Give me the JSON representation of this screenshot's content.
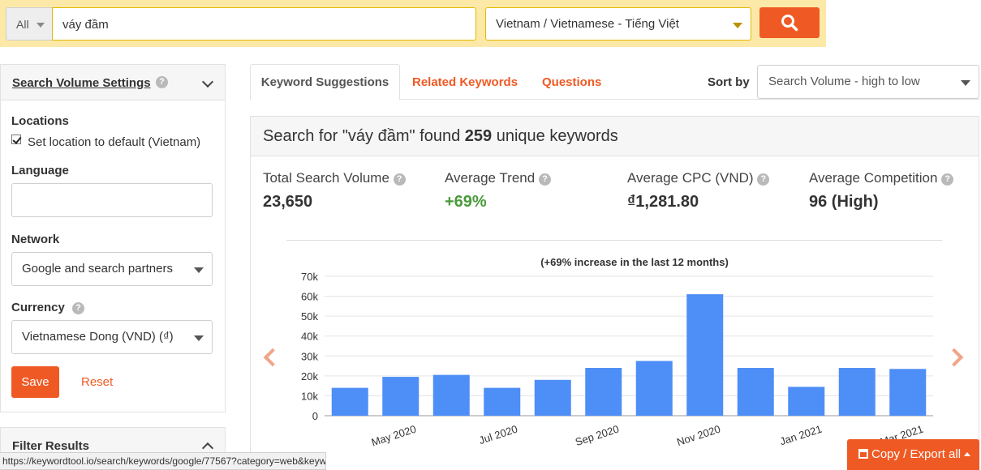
{
  "search": {
    "scope": "All",
    "query": "váy đầm",
    "language": "Vietnam / Vietnamese - Tiếng Việt"
  },
  "sidebar": {
    "title": "Search Volume Settings",
    "locations_label": "Locations",
    "location_default_label": "Set location to default (Vietnam)",
    "location_default_checked": true,
    "language_label": "Language",
    "language_value": "",
    "network_label": "Network",
    "network_value": "Google and search partners",
    "currency_label": "Currency",
    "currency_value": "Vietnamese Dong (VND) (₫)",
    "save_label": "Save",
    "reset_label": "Reset",
    "filter_title": "Filter Results"
  },
  "tabs": {
    "items": [
      "Keyword Suggestions",
      "Related Keywords",
      "Questions"
    ],
    "active": "Keyword Suggestions",
    "sort_label": "Sort by",
    "sort_value": "Search Volume - high to low"
  },
  "results": {
    "prefix": "Search for \"váy đầm\" found ",
    "count": "259",
    "suffix": " unique keywords",
    "stats": [
      {
        "label": "Total Search Volume",
        "value": "23,650"
      },
      {
        "label": "Average Trend",
        "value": "+69%"
      },
      {
        "label": "Average CPC (VND)",
        "value": "₫1,281.80"
      },
      {
        "label": "Average Competition",
        "value": "96 (High)"
      }
    ]
  },
  "chart_data": {
    "type": "bar",
    "title": "(+69% increase in the last 12 months)",
    "categories": [
      "Apr 2020",
      "May 2020",
      "Jun 2020",
      "Jul 2020",
      "Aug 2020",
      "Sep 2020",
      "Oct 2020",
      "Nov 2020",
      "Dec 2020",
      "Jan 2021",
      "Feb 2021",
      "Mar 2021"
    ],
    "x_tick_labels": [
      "May 2020",
      "Jul 2020",
      "Sep 2020",
      "Nov 2020",
      "Jan 2021",
      "Mar 2021"
    ],
    "values": [
      14000,
      19500,
      20500,
      14000,
      18000,
      24000,
      27500,
      61000,
      24000,
      14500,
      24000,
      23500
    ],
    "y_ticks": [
      "0",
      "10k",
      "20k",
      "30k",
      "40k",
      "50k",
      "60k",
      "70k"
    ],
    "ylim": [
      0,
      70000
    ],
    "bar_color": "#4e8ef7",
    "grid": true
  },
  "statusbar": {
    "url": "https://keywordtool.io/search/keywords/google/77567?category=web&keyw..."
  },
  "export": {
    "label": "Copy / Export all"
  },
  "colors": {
    "accent": "#ef5a24",
    "topbar": "#fce9a7",
    "trend_positive": "#4a9a3a"
  }
}
